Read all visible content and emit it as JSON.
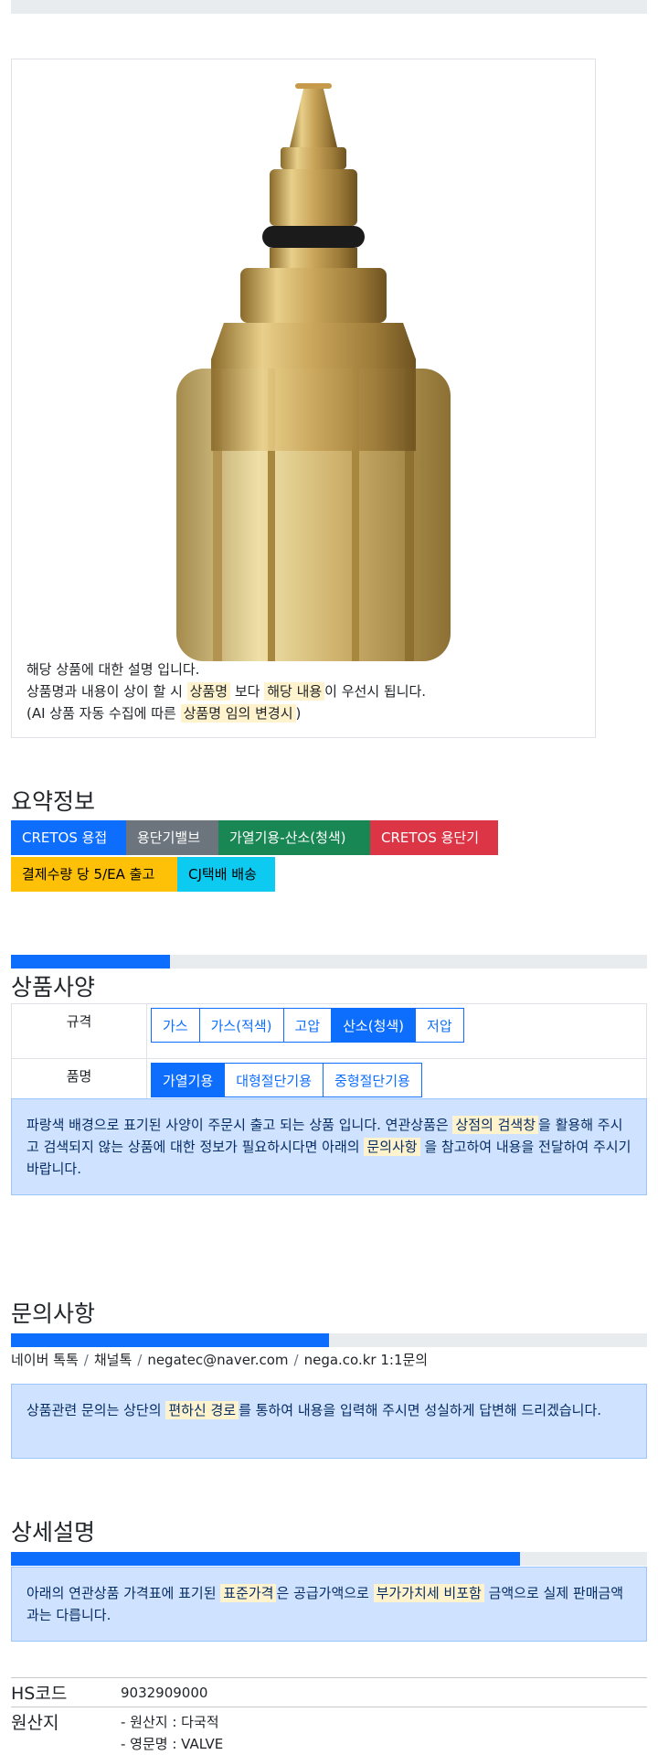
{
  "caption": {
    "line1": "해당 상품에 대한 설명 입니다.",
    "line2_a": "상품명과 내용이 상이 할 시 ",
    "line2_hl1": "상품명",
    "line2_b": " 보다 ",
    "line2_hl2": "해당 내용",
    "line2_c": "이 우선시 됩니다.",
    "line3_a": "(AI 상품 자동 수집에 따른 ",
    "line3_hl": "상품명 임의 변경시",
    "line3_b": ")"
  },
  "summary": {
    "title": "요약정보",
    "badges": [
      "CRETOS 용접",
      "용단기밸브",
      "가열기용-산소(청색)",
      "CRETOS 용단기",
      "결제수량 당 5/EA 출고",
      "CJ택배 배송"
    ]
  },
  "spec": {
    "title": "상품사양",
    "progress": 0.25,
    "rows": [
      {
        "label": "규격",
        "options": [
          "가스",
          "가스(적색)",
          "고압",
          "산소(청색)",
          "저압"
        ],
        "selected": 3
      },
      {
        "label": "품명",
        "options": [
          "가열기용",
          "대형절단기용",
          "중형절단기용"
        ],
        "selected": 0
      }
    ],
    "notice_a": "파랑색 배경으로 표기된 사양이 주문시 출고 되는 상품 입니다. 연관상품은 ",
    "notice_hl1": "상점의 검색창",
    "notice_b": "을 활용해 주시고 검색되지 않는 상품에 대한 정보가 필요하시다면 아래의 ",
    "notice_hl2": "문의사항",
    "notice_c": " 을 참고하여 내용을 전달하여 주시기 바랍니다."
  },
  "inquiry": {
    "title": "문의사항",
    "progress": 0.5,
    "links": [
      "네이버 톡톡",
      "채널톡",
      "negatec@naver.com",
      "nega.co.kr 1:1문의"
    ],
    "separator": "/",
    "notice_a": "상품관련 문의는 상단의 ",
    "notice_hl": "편하신 경로",
    "notice_b": "를 통하여 내용을 입력해 주시면 성실하게 답변해 드리겠습니다."
  },
  "detail": {
    "title": "상세설명",
    "progress": 0.8,
    "notice_a": "아래의 연관상품 가격표에 표기된 ",
    "notice_hl1": "표준가격",
    "notice_b": "은 공급가액으로 ",
    "notice_hl2": "부가가치세 비포함",
    "notice_c": " 금액으로 실제 판매금액과는 다릅니다."
  },
  "info": {
    "hs_label": "HS코드",
    "hs_value": "9032909000",
    "origin_label": "원산지",
    "origin_line1": "- 원산지 : 다국적",
    "origin_line2": "- 영문명 : VALVE"
  },
  "colors": {
    "primary": "#0d6efd",
    "secondary": "#6c757d",
    "success": "#198754",
    "danger": "#dc3545",
    "warning": "#ffc107",
    "info": "#0dcaf0",
    "alert_bg": "#cfe2ff",
    "highlight": "#fff3cd"
  }
}
